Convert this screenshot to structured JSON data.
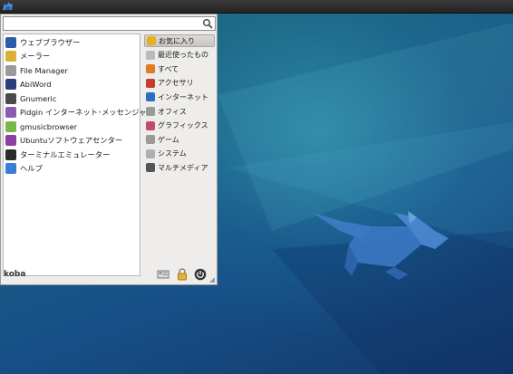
{
  "menu": {
    "search": {
      "value": "",
      "placeholder": ""
    },
    "favorites": [
      {
        "label": "ウェブブラウザー",
        "icon": "web-browser-icon",
        "color": "#2a5fa8"
      },
      {
        "label": "メーラー",
        "icon": "mail-icon",
        "color": "#d9b03a"
      },
      {
        "label": "File Manager",
        "icon": "file-manager-icon",
        "color": "#9a9a9a"
      },
      {
        "label": "AbiWord",
        "icon": "abiword-icon",
        "color": "#2b3f7a"
      },
      {
        "label": "Gnumeric",
        "icon": "gnumeric-icon",
        "color": "#4a4a4a"
      },
      {
        "label": "Pidgin インターネット･メッセンジャー",
        "icon": "pidgin-icon",
        "color": "#8b5bb0"
      },
      {
        "label": "gmusicbrowser",
        "icon": "gmusicbrowser-icon",
        "color": "#7ab648"
      },
      {
        "label": "Ubuntuソフトウェアセンター",
        "icon": "software-center-icon",
        "color": "#8e3fa0"
      },
      {
        "label": "ターミナルエミュレーター",
        "icon": "terminal-icon",
        "color": "#2b2b2b"
      },
      {
        "label": "ヘルプ",
        "icon": "help-icon",
        "color": "#3b7fd4"
      }
    ],
    "categories": [
      {
        "label": "お気に入り",
        "icon": "star-icon",
        "color": "#e8b020",
        "selected": true
      },
      {
        "label": "最近使ったもの",
        "icon": "clock-icon",
        "color": "#bbbbbb"
      },
      {
        "label": "すべて",
        "icon": "all-apps-icon",
        "color": "#e07b20"
      },
      {
        "label": "アクセサリ",
        "icon": "accessories-icon",
        "color": "#c83a2a"
      },
      {
        "label": "インターネット",
        "icon": "internet-icon",
        "color": "#2a6fc0"
      },
      {
        "label": "オフィス",
        "icon": "office-icon",
        "color": "#9a9a9a"
      },
      {
        "label": "グラフィックス",
        "icon": "graphics-icon",
        "color": "#c24a6a"
      },
      {
        "label": "ゲーム",
        "icon": "games-icon",
        "color": "#9a9a9a"
      },
      {
        "label": "システム",
        "icon": "system-icon",
        "color": "#b0b0b0"
      },
      {
        "label": "マルチメディア",
        "icon": "multimedia-icon",
        "color": "#555555"
      }
    ],
    "user": "koba"
  }
}
